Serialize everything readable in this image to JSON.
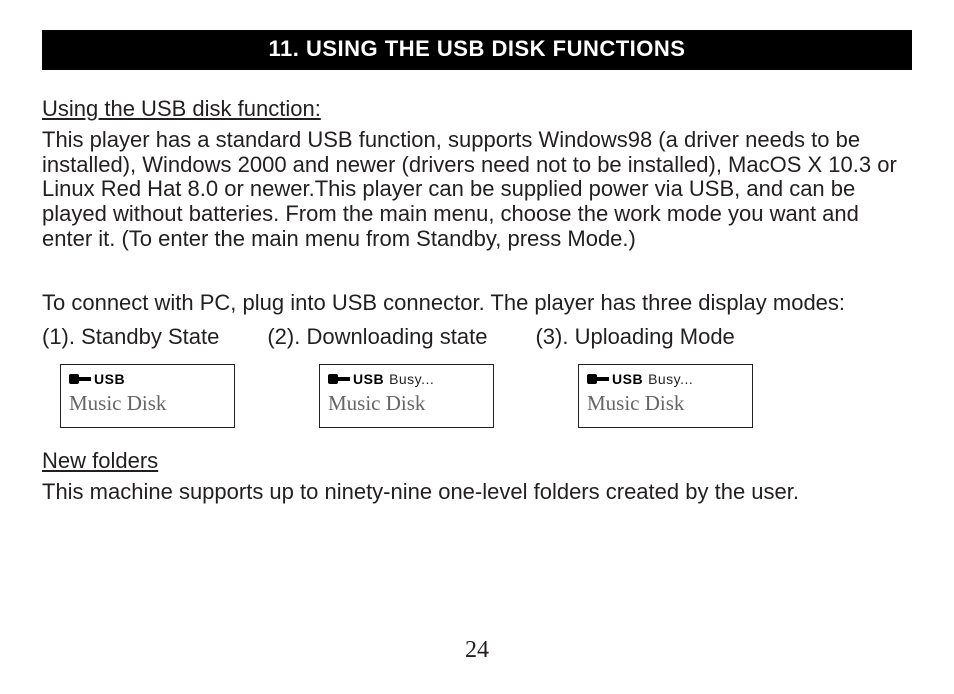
{
  "section": {
    "title": "11. USING THE USB DISK FUNCTIONS"
  },
  "usb": {
    "heading": "Using the USB disk function:",
    "body": "This player has a standard USB function, supports Windows98 (a driver needs to be installed), Windows 2000 and newer (drivers need not to be installed), MacOS X 10.3 or Linux Red Hat 8.0 or newer.This player can be supplied power via USB, and can be played without batteries. From the main menu, choose the work mode you want and enter it.  (To enter the main menu from Standby, press Mode.)",
    "connect": "To connect with PC, plug into USB connector. The player has three display modes:",
    "modes": {
      "m1": "(1). Standby State",
      "m2": "(2). Downloading state",
      "m3": "(3). Uploading Mode"
    },
    "displays": {
      "d1": {
        "top": "USB",
        "busy": "",
        "bottom": "Music Disk"
      },
      "d2": {
        "top": "USB",
        "busy": "Busy...",
        "bottom": "Music Disk"
      },
      "d3": {
        "top": "USB",
        "busy": "Busy...",
        "bottom": "Music Disk"
      }
    }
  },
  "folders": {
    "heading": "New folders",
    "body": "This machine supports up to ninety-nine one-level folders created by the user."
  },
  "page_number": "24"
}
